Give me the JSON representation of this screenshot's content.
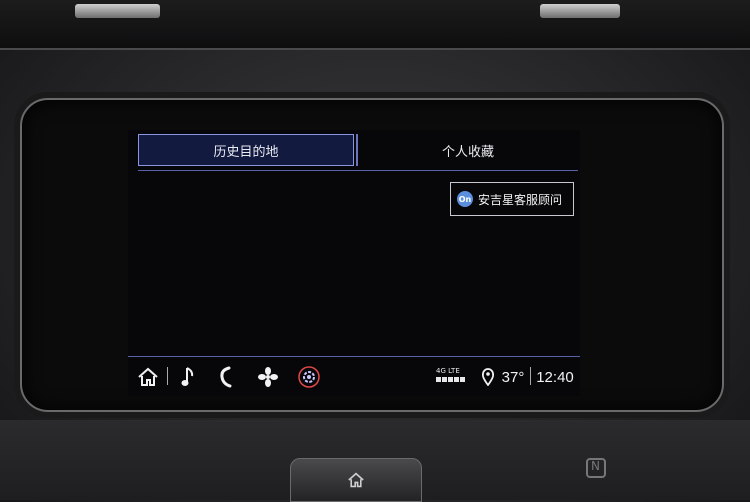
{
  "tabs": {
    "history": "历史目的地",
    "favorites": "个人收藏"
  },
  "service_button": {
    "icon_text": "On",
    "label": "安吉星客服顾问"
  },
  "status_bar": {
    "network": "4G LTE",
    "temperature": "37°",
    "time": "12:40"
  },
  "icons": [
    "home-icon",
    "music-note-icon",
    "phone-icon",
    "fan-icon",
    "settings-icon",
    "location-pin-icon",
    "signal-bars-icon"
  ],
  "colors": {
    "accent": "#8c95e0",
    "active_tab_bg": "#121a40",
    "settings_ring": "#e04848"
  }
}
